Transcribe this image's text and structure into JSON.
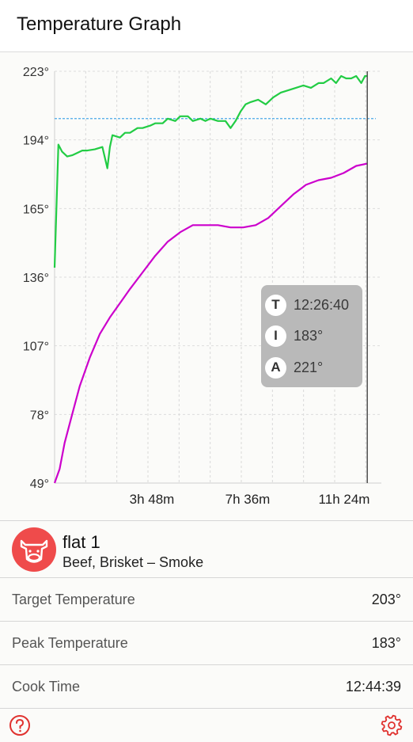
{
  "header": {
    "title": "Temperature Graph"
  },
  "chart_data": {
    "type": "line",
    "y_ticks": [
      "223°",
      "194°",
      "165°",
      "136°",
      "107°",
      "78°",
      "49°"
    ],
    "x_ticks": [
      "3h 48m",
      "7h 36m",
      "11h 24m"
    ],
    "ylim": [
      49,
      223
    ],
    "xlim_hours": [
      0,
      13.0
    ],
    "target_line": 203,
    "cursor_hour": 12.44,
    "series": [
      {
        "color": "#22cc44",
        "x": [
          0,
          0.15,
          0.3,
          0.5,
          0.7,
          0.9,
          1.1,
          1.3,
          1.6,
          1.9,
          2.1,
          2.2,
          2.3,
          2.6,
          2.8,
          3.0,
          3.3,
          3.5,
          3.8,
          4.0,
          4.3,
          4.5,
          4.8,
          5.0,
          5.3,
          5.5,
          5.8,
          6.0,
          6.2,
          6.5,
          6.8,
          7.0,
          7.2,
          7.4,
          7.6,
          7.8,
          8.1,
          8.4,
          8.7,
          9.0,
          9.3,
          9.6,
          9.9,
          10.2,
          10.5,
          10.7,
          11.0,
          11.2,
          11.4,
          11.6,
          11.8,
          12.0,
          12.2,
          12.35,
          12.44
        ],
        "y": [
          140,
          192,
          189,
          187,
          187.5,
          188.5,
          189.5,
          189.5,
          190,
          191,
          182,
          191,
          196,
          195,
          197,
          197,
          199,
          199,
          200,
          201,
          201,
          203,
          202,
          204,
          204,
          202,
          203,
          202,
          203,
          202,
          202,
          199,
          202,
          206,
          209,
          210,
          211,
          209,
          212,
          214,
          215,
          216,
          217,
          216,
          218,
          218,
          220,
          218,
          221,
          220,
          220,
          221,
          218,
          221,
          221
        ]
      },
      {
        "color": "#cc00cc",
        "x": [
          0,
          0.2,
          0.4,
          0.7,
          1.0,
          1.4,
          1.8,
          2.2,
          2.6,
          3.0,
          3.5,
          4.0,
          4.5,
          5.0,
          5.5,
          6.0,
          6.5,
          7.0,
          7.5,
          8.0,
          8.5,
          9.0,
          9.5,
          10.0,
          10.5,
          11.0,
          11.5,
          12.0,
          12.44
        ],
        "y": [
          49,
          55,
          66,
          78,
          90,
          102,
          112,
          119,
          125,
          131,
          138,
          145,
          151,
          155,
          158,
          158,
          158,
          157,
          157,
          158,
          161,
          166,
          171,
          175,
          177,
          178,
          180,
          183,
          184
        ]
      }
    ]
  },
  "tooltip": {
    "rows": [
      {
        "key": "T",
        "value": "12:26:40"
      },
      {
        "key": "I",
        "value": "183°"
      },
      {
        "key": "A",
        "value": "221°"
      }
    ]
  },
  "cook": {
    "name": "flat 1",
    "subtitle": "Beef, Brisket – Smoke",
    "avatar_color": "#ef4b4b"
  },
  "stats": [
    {
      "label": "Target Temperature",
      "value": "203°"
    },
    {
      "label": "Peak Temperature",
      "value": "183°"
    },
    {
      "label": "Cook Time",
      "value": "12:44:39"
    }
  ],
  "footer": {
    "help_icon": "help-icon",
    "settings_icon": "gear-icon",
    "accent": "#e0322f"
  }
}
